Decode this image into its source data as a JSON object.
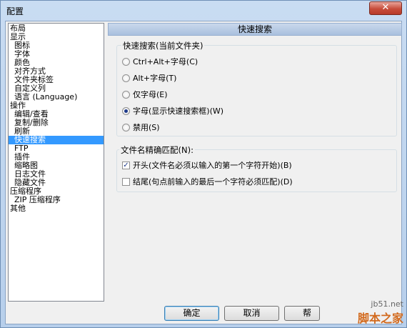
{
  "window": {
    "title": "配置",
    "close_glyph": "✕"
  },
  "tree": {
    "items": [
      {
        "label": "布局",
        "indent": 0
      },
      {
        "label": "显示",
        "indent": 0
      },
      {
        "label": "图标",
        "indent": 1
      },
      {
        "label": "字体",
        "indent": 1
      },
      {
        "label": "颜色",
        "indent": 1
      },
      {
        "label": "对齐方式",
        "indent": 1
      },
      {
        "label": "文件夹标签",
        "indent": 1
      },
      {
        "label": "自定义列",
        "indent": 1
      },
      {
        "label": "语言 (Language)",
        "indent": 1
      },
      {
        "label": "操作",
        "indent": 0
      },
      {
        "label": "编辑/查看",
        "indent": 1
      },
      {
        "label": "复制/删除",
        "indent": 1
      },
      {
        "label": "刷新",
        "indent": 1
      },
      {
        "label": "快速搜索",
        "indent": 1,
        "selected": true
      },
      {
        "label": "FTP",
        "indent": 1
      },
      {
        "label": "插件",
        "indent": 1
      },
      {
        "label": "缩略图",
        "indent": 1
      },
      {
        "label": "日志文件",
        "indent": 1
      },
      {
        "label": "隐藏文件",
        "indent": 1
      },
      {
        "label": "压缩程序",
        "indent": 0
      },
      {
        "label": "ZIP 压缩程序",
        "indent": 1
      },
      {
        "label": "其他",
        "indent": 0
      }
    ]
  },
  "panel": {
    "header": "快速搜索",
    "group1": {
      "title": "快速搜索(当前文件夹)",
      "options": [
        {
          "label": "Ctrl+Alt+字母(C)",
          "checked": false
        },
        {
          "label": "Alt+字母(T)",
          "checked": false
        },
        {
          "label": "仅字母(E)",
          "checked": false
        },
        {
          "label": "字母(显示快速搜索框)(W)",
          "checked": true
        },
        {
          "label": "禁用(S)",
          "checked": false
        }
      ]
    },
    "group2": {
      "title": "文件名精确匹配(N):",
      "options": [
        {
          "label": "开头(文件名必须以输入的第一个字符开始)(B)",
          "checked": true
        },
        {
          "label": "结尾(句点前输入的最后一个字符必须匹配)(D)",
          "checked": false
        }
      ]
    }
  },
  "buttons": {
    "ok": "确定",
    "cancel": "取消",
    "help": "帮"
  },
  "watermark": {
    "url": "jb51.net",
    "text": "脚本之家"
  },
  "colors": {
    "selection": "#3399ff",
    "close": "#c74d3b",
    "watermark": "#d26a1e"
  }
}
